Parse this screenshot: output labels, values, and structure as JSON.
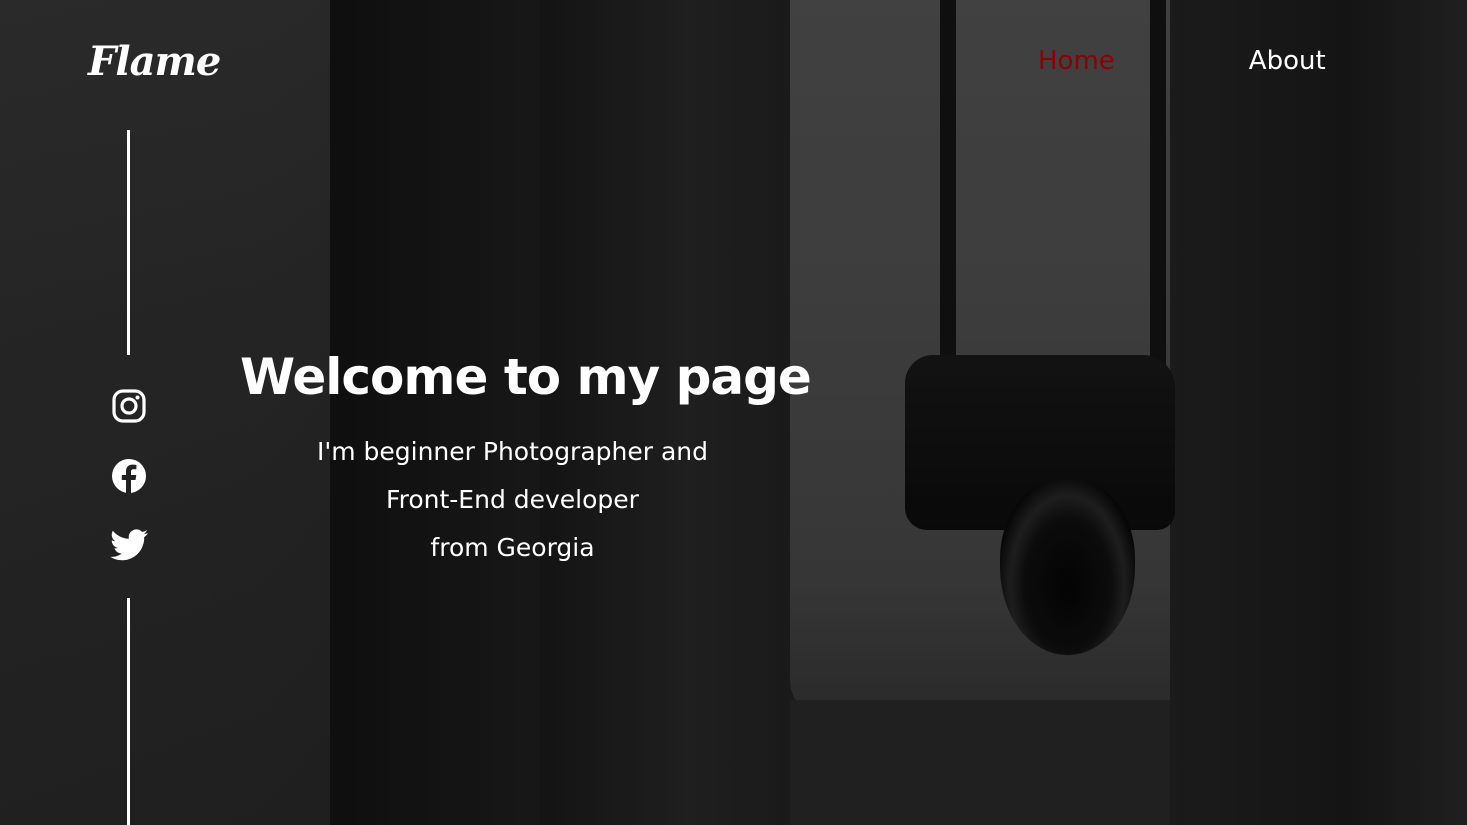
{
  "brand": {
    "logo_text": "Flame"
  },
  "nav": {
    "items": [
      {
        "label": "Home",
        "active": true
      },
      {
        "label": "About",
        "active": false
      }
    ],
    "active_color": "#8b0000",
    "default_color": "#ffffff"
  },
  "hero": {
    "headline": "Welcome to my page",
    "tagline_lines": [
      "I'm beginner Photographer and",
      "Front-End developer",
      "from Georgia"
    ],
    "background": "black-and-white photo of a person in a jacket with a camera hanging from a neck strap"
  },
  "social": [
    {
      "icon": "instagram-icon"
    },
    {
      "icon": "facebook-icon"
    },
    {
      "icon": "twitter-icon"
    }
  ]
}
